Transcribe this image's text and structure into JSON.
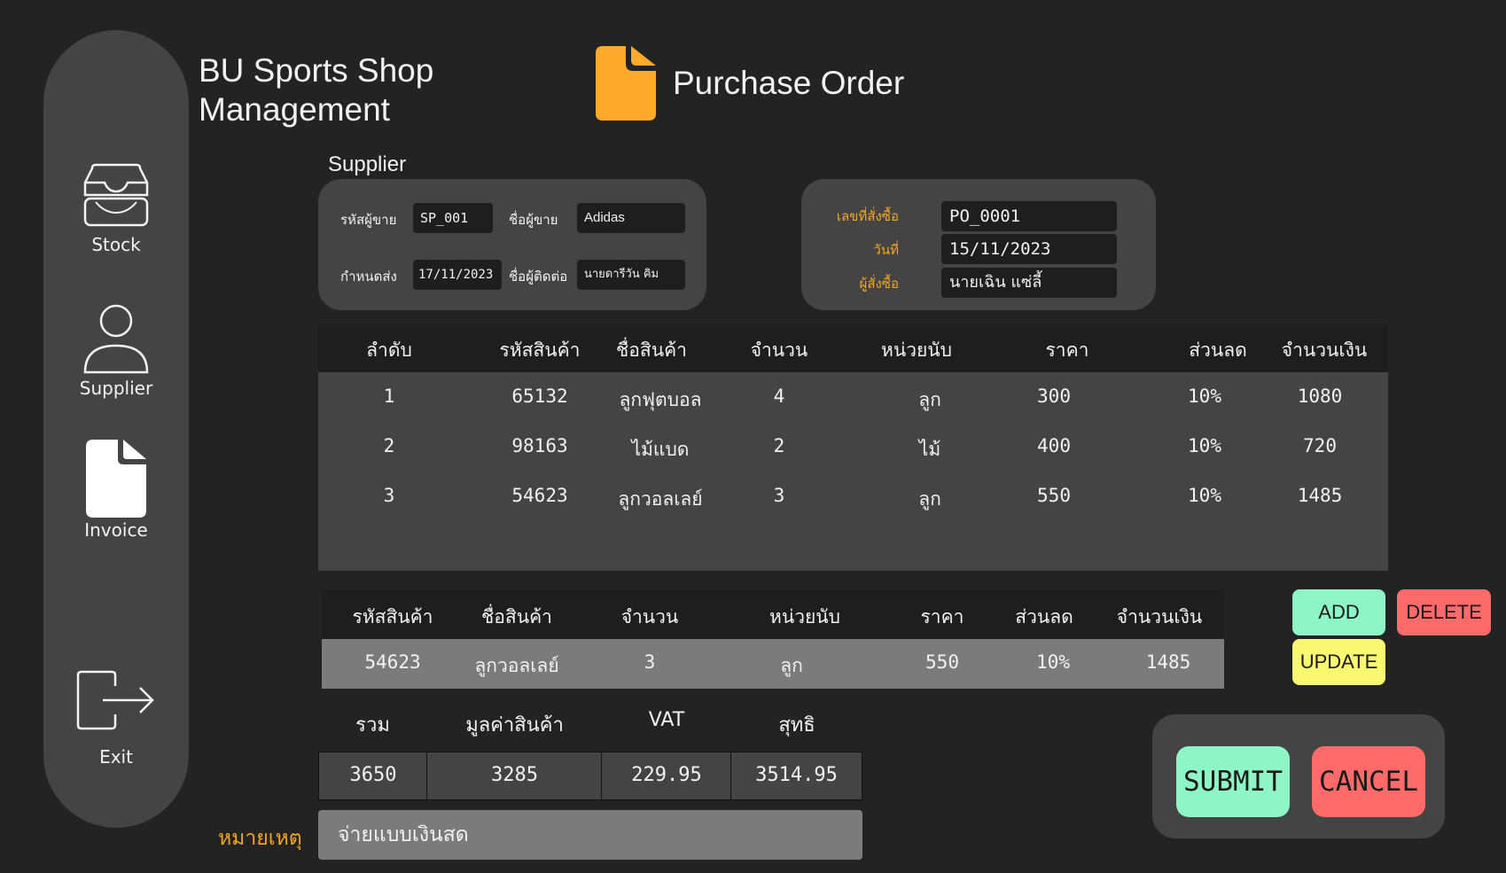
{
  "app": {
    "title_line1": "BU Sports Shop",
    "title_line2": "Management"
  },
  "page": {
    "title": "Purchase Order",
    "icon": "document-icon"
  },
  "sidebar": {
    "items": [
      {
        "label": "Stock",
        "icon": "inbox-tray-icon"
      },
      {
        "label": "Supplier",
        "icon": "user-icon"
      },
      {
        "label": "Invoice",
        "icon": "document-icon"
      },
      {
        "label": "Exit",
        "icon": "exit-icon"
      }
    ]
  },
  "supplier": {
    "section_label": "Supplier",
    "code_label": "รหัสผู้ขาย",
    "code_value": "SP_001",
    "name_label": "ชื่อผู้ขาย",
    "name_value": "Adidas",
    "due_label": "กำหนดส่ง",
    "due_value": "17/11/2023",
    "contact_label": "ชื่อผู้ติดต่อ",
    "contact_value": "นายดารีวัน คิม"
  },
  "order": {
    "po_label": "เลขที่สั่งซื้อ",
    "po_value": "PO_0001",
    "date_label": "วันที่",
    "date_value": "15/11/2023",
    "buyer_label": "ผู้สั่งซื้อ",
    "buyer_value": "นายเฉิน แซ่ลี้"
  },
  "items_table": {
    "headers": [
      "ลำดับ",
      "รหัสสินค้า",
      "ชื่อสินค้า",
      "จำนวน",
      "หน่วยนับ",
      "ราคา",
      "ส่วนลด",
      "จำนวนเงิน"
    ],
    "rows": [
      [
        "1",
        "65132",
        "ลูกฟุตบอล",
        "4",
        "ลูก",
        "300",
        "10%",
        "1080"
      ],
      [
        "2",
        "98163",
        "ไม้แบด",
        "2",
        "ไม้",
        "400",
        "10%",
        "720"
      ],
      [
        "3",
        "54623",
        "ลูกวอลเลย์",
        "3",
        "ลูก",
        "550",
        "10%",
        "1485"
      ]
    ]
  },
  "entry_table": {
    "headers": [
      "รหัสสินค้า",
      "ชื่อสินค้า",
      "จำนวน",
      "หน่วยนับ",
      "ราคา",
      "ส่วนลด",
      "จำนวนเงิน"
    ],
    "row": [
      "54623",
      "ลูกวอลเลย์",
      "3",
      "ลูก",
      "550",
      "10%",
      "1485"
    ]
  },
  "actions": {
    "add": "ADD",
    "delete": "DELETE",
    "update": "UPDATE"
  },
  "totals": {
    "headers": [
      "รวม",
      "มูลค่าสินค้า",
      "VAT",
      "สุทธิ"
    ],
    "values": [
      "3650",
      "3285",
      "229.95",
      "3514.95"
    ]
  },
  "note": {
    "label": "หมายเหตุ",
    "value": "จ่ายแบบเงินสด"
  },
  "submit": {
    "submit": "SUBMIT",
    "cancel": "CANCEL"
  },
  "colors": {
    "background": "#232323",
    "panel": "#444444",
    "accent_orange": "#f5a623",
    "mint": "#8df5c6",
    "red": "#ff6b6b",
    "yellow": "#f9f871"
  }
}
